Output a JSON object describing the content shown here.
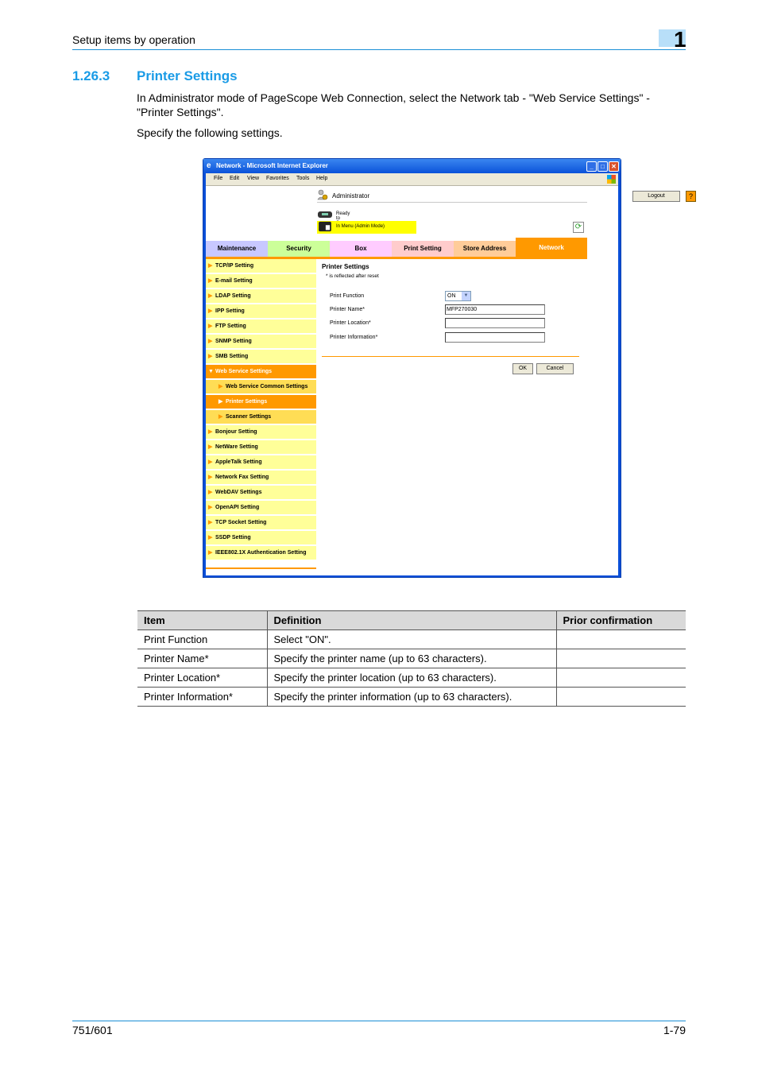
{
  "page_header": {
    "running_title": "Setup items by operation",
    "chapter_number": "1"
  },
  "section": {
    "number": "1.26.3",
    "title": "Printer Settings",
    "intro": "In Administrator mode of PageScope Web Connection, select the Network tab - \"Web Service Settings\" - \"Printer Settings\".",
    "instruction": "Specify the following settings."
  },
  "screenshot": {
    "window_title": "Network - Microsoft Internet Explorer",
    "window_buttons": {
      "minimize": "_",
      "maximize": "□",
      "close": "✕"
    },
    "menu": [
      "File",
      "Edit",
      "View",
      "Favorites",
      "Tools",
      "Help"
    ],
    "user_label": "Administrator",
    "logout_label": "Logout",
    "help_label": "?",
    "status_ready": "Ready to Scan",
    "status_mode": "In Menu (Admin Mode)",
    "refresh_icon": "⟳",
    "tabs": [
      {
        "label": "Maintenance"
      },
      {
        "label": "Security"
      },
      {
        "label": "Box"
      },
      {
        "label": "Print Setting"
      },
      {
        "label": "Store Address"
      },
      {
        "label": "Network",
        "active": true
      }
    ],
    "sidebar": [
      {
        "label": "TCP/IP Setting"
      },
      {
        "label": "E-mail Setting"
      },
      {
        "label": "LDAP Setting"
      },
      {
        "label": "IPP Setting"
      },
      {
        "label": "FTP Setting"
      },
      {
        "label": "SNMP Setting"
      },
      {
        "label": "SMB Setting"
      },
      {
        "label": "Web Service Settings",
        "expanded": true
      },
      {
        "label": "Web Service Common Settings",
        "sub": true
      },
      {
        "label": "Printer Settings",
        "sub": true,
        "active": true
      },
      {
        "label": "Scanner Settings",
        "sub": true
      },
      {
        "label": "Bonjour Setting"
      },
      {
        "label": "NetWare Setting"
      },
      {
        "label": "AppleTalk Setting"
      },
      {
        "label": "Network Fax Setting"
      },
      {
        "label": "WebDAV Settings"
      },
      {
        "label": "OpenAPI Setting"
      },
      {
        "label": "TCP Socket Setting"
      },
      {
        "label": "SSDP Setting"
      },
      {
        "label": "IEEE802.1X Authentication Setting"
      }
    ],
    "form": {
      "title": "Printer Settings",
      "note": "* is reflected after reset",
      "print_function_label": "Print Function",
      "print_function_value": "ON",
      "printer_name_label": "Printer Name*",
      "printer_name_value": "MFP270030",
      "printer_location_label": "Printer Location*",
      "printer_location_value": "",
      "printer_information_label": "Printer Information*",
      "printer_information_value": "",
      "ok_label": "OK",
      "cancel_label": "Cancel"
    }
  },
  "table": {
    "headers": [
      "Item",
      "Definition",
      "Prior confirmation"
    ],
    "rows": [
      [
        "Print Function",
        "Select \"ON\".",
        ""
      ],
      [
        "Printer Name*",
        "Specify the printer name (up to 63 characters).",
        ""
      ],
      [
        "Printer Location*",
        "Specify the printer location (up to 63 characters).",
        ""
      ],
      [
        "Printer Information*",
        "Specify the printer information (up to 63 characters).",
        ""
      ]
    ]
  },
  "page_footer": {
    "model": "751/601",
    "page_number": "1-79"
  }
}
